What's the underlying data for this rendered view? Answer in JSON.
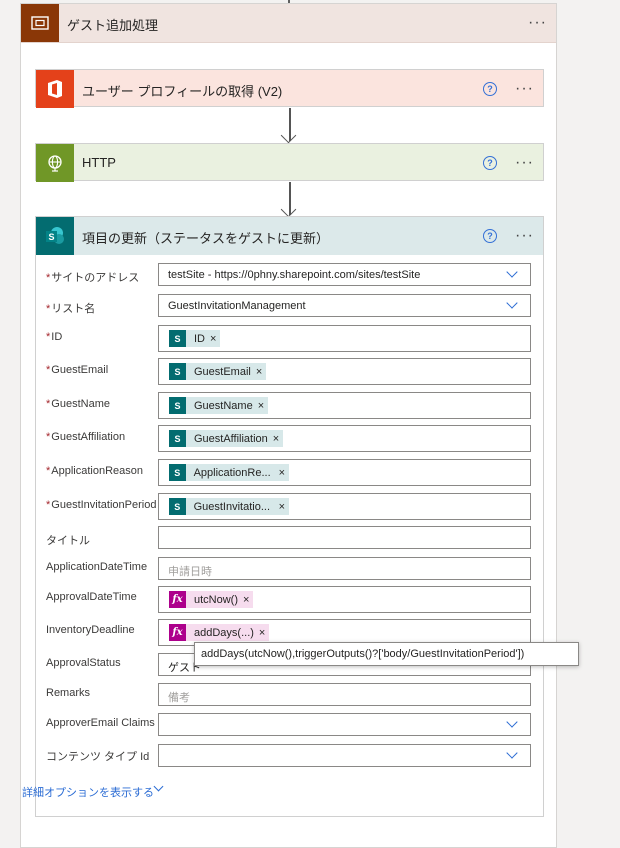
{
  "scope": {
    "title": "ゲスト追加処理"
  },
  "actions": [
    {
      "title": "ユーザー プロフィールの取得 (V2)",
      "icon": "office-icon",
      "color": "#e4411a",
      "bg": "#fbe4de"
    },
    {
      "title": "HTTP",
      "icon": "globe-icon",
      "color": "#709727",
      "bg": "#eaf1e0"
    },
    {
      "title": "項目の更新（ステータスをゲストに更新）",
      "icon": "sharepoint-icon",
      "color": "#036c70",
      "bg": "#dce9ea"
    }
  ],
  "form": {
    "site_label": "サイトのアドレス",
    "site_value": "testSite - https://0phny.sharepoint.com/sites/testSite",
    "list_label": "リスト名",
    "list_value": "GuestInvitationManagement",
    "id_label": "ID",
    "id_token": "ID",
    "email_label": "GuestEmail",
    "email_token": "GuestEmail",
    "name_label": "GuestName",
    "name_token": "GuestName",
    "affil_label": "GuestAffiliation",
    "affil_token": "GuestAffiliation",
    "reason_label": "ApplicationReason",
    "reason_token": "ApplicationRe...",
    "period_label": "GuestInvitationPeriod",
    "period_token": "GuestInvitatio...",
    "title_label": "タイトル",
    "appdate_label": "ApplicationDateTime",
    "appdate_placeholder": "申請日時",
    "approvaldate_label": "ApprovalDateTime",
    "approvaldate_token": "utcNow()",
    "deadline_label": "InventoryDeadline",
    "deadline_token": "addDays(...)",
    "status_label": "ApprovalStatus",
    "status_value": "ゲスト",
    "remarks_label": "Remarks",
    "remarks_placeholder": "備考",
    "approver_label": "ApproverEmail Claims",
    "ctype_label": "コンテンツ タイプ Id",
    "advanced_label": "詳細オプションを表示する"
  },
  "tooltip": "addDays(utcNow(),triggerOutputs()?['body/GuestInvitationPeriod'])",
  "ui": {
    "more": "···",
    "help": "?",
    "remove": "×",
    "sp_letter": "S",
    "fx": "fx"
  }
}
